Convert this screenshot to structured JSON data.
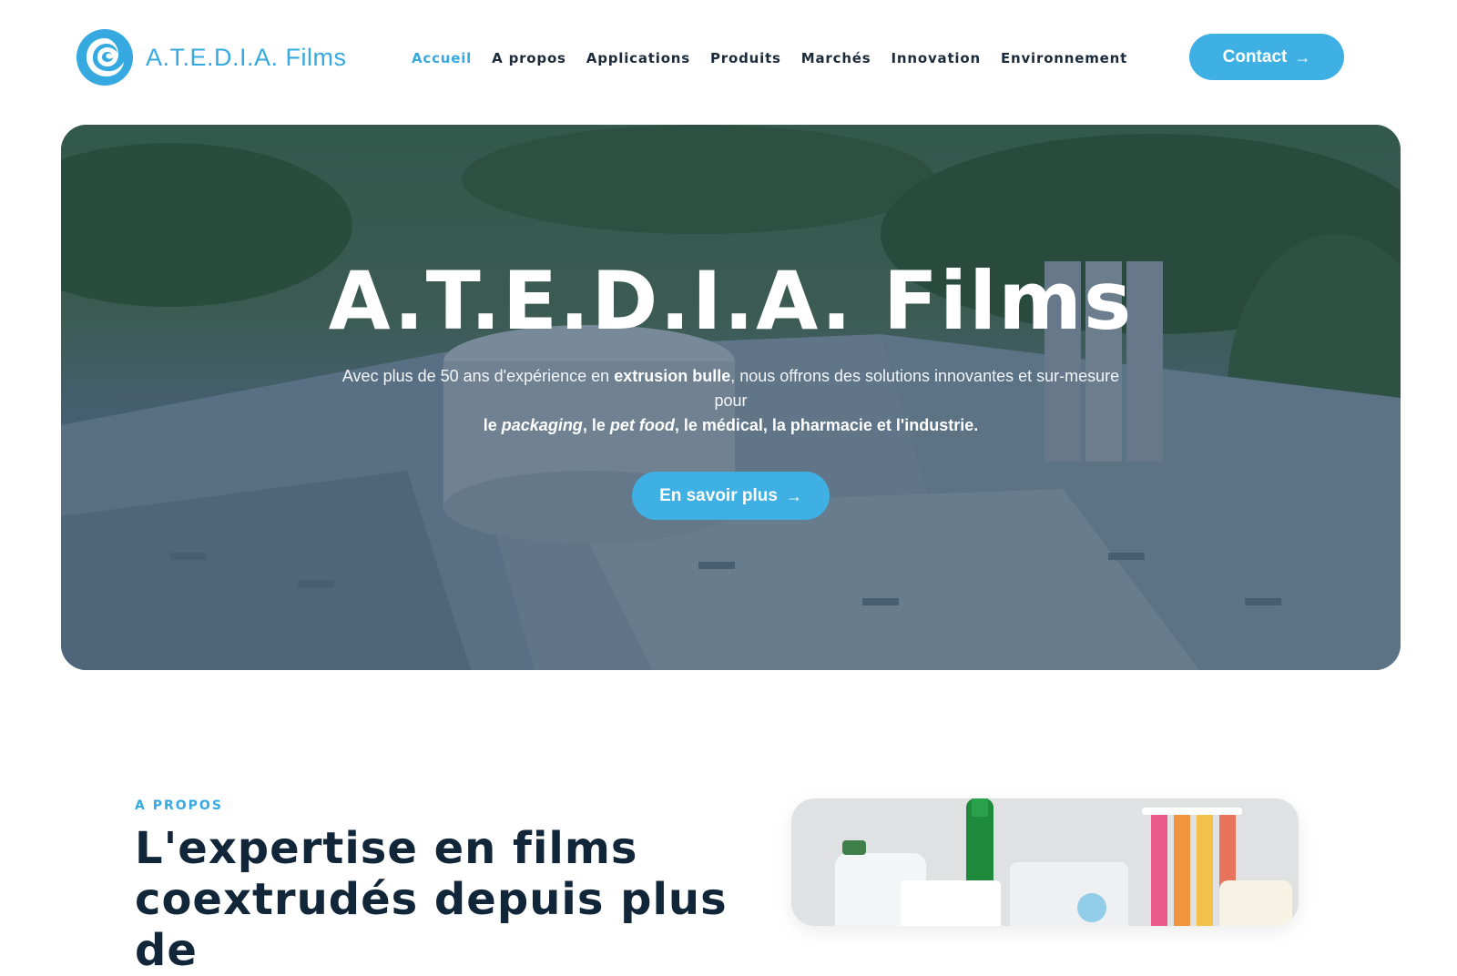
{
  "header": {
    "logo_text": "A.T.E.D.I.A. Films",
    "nav": [
      {
        "label": "Accueil",
        "active": true
      },
      {
        "label": "A propos",
        "active": false
      },
      {
        "label": "Applications",
        "active": false
      },
      {
        "label": "Produits",
        "active": false
      },
      {
        "label": "Marchés",
        "active": false
      },
      {
        "label": "Innovation",
        "active": false
      },
      {
        "label": "Environnement",
        "active": false
      }
    ],
    "contact_label": "Contact",
    "arrow_icon": "arrow-right-icon"
  },
  "hero": {
    "title": "A.T.E.D.I.A. Films",
    "subtitle_parts": {
      "p1": "Avec plus de 50 ans d'expérience en ",
      "p2": "extrusion bulle",
      "p3": ", nous offrons des solutions innovantes et sur-mesure pour ",
      "p4": "le ",
      "p5": "packaging",
      "p6": ", le ",
      "p7": "pet food",
      "p8": ", le médical, la pharmacie et l'industrie."
    },
    "cta_label": "En savoir plus"
  },
  "about": {
    "eyebrow": "A PROPOS",
    "title": "L'expertise en films coextrudés depuis plus de"
  },
  "colors": {
    "accent": "#36a9e1",
    "button": "#3fb0e3",
    "nav_text": "#1c2b3b",
    "heading": "#12263a"
  }
}
